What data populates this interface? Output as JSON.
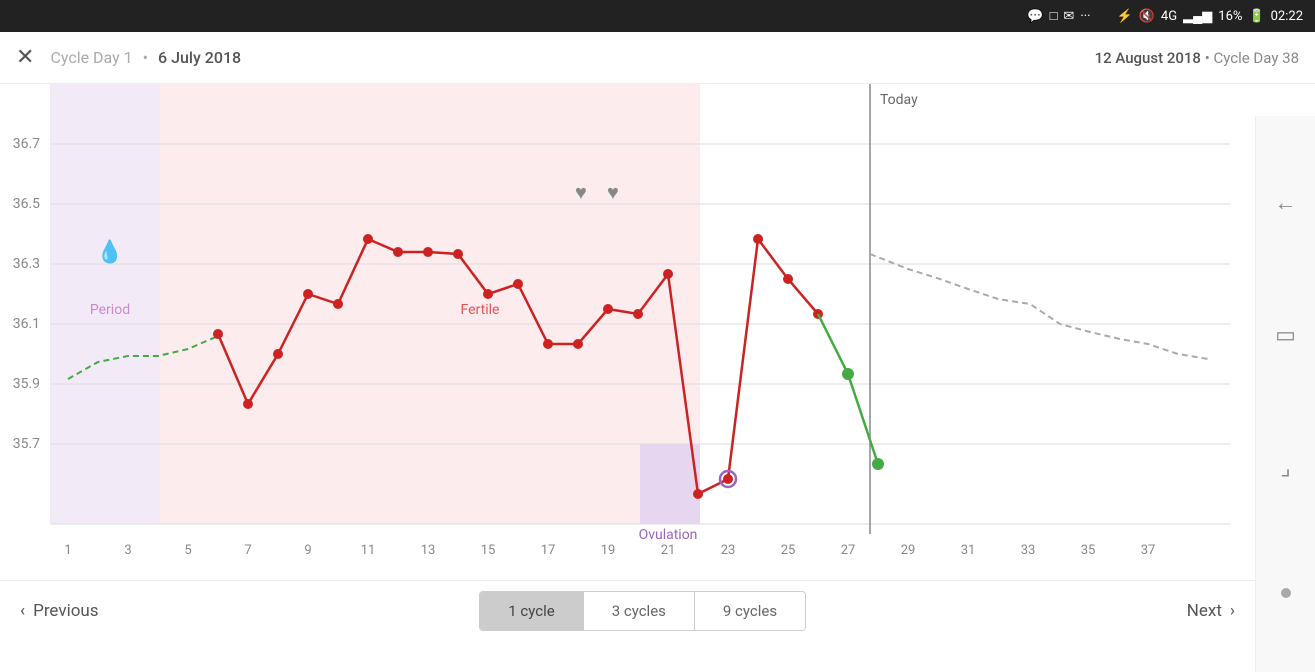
{
  "statusBar": {
    "icons": "bluetooth wifi signal battery",
    "battery": "16%",
    "time": "02:22"
  },
  "header": {
    "cycleDay": "Cycle Day 1",
    "dot": "•",
    "date": "6 July 2018",
    "rightDate": "12 August 2018",
    "rightDot": "•",
    "rightCycleDay": "Cycle Day 38"
  },
  "chart": {
    "yLabels": [
      "36.7",
      "36.5",
      "36.3",
      "36.1",
      "35.9",
      "35.7"
    ],
    "xLabels": [
      "1",
      "3",
      "5",
      "7",
      "9",
      "11",
      "13",
      "15",
      "17",
      "19",
      "21",
      "23",
      "25",
      "27",
      "29",
      "31",
      "33",
      "35",
      "37"
    ],
    "labels": {
      "period": "Period",
      "fertile": "Fertile",
      "ovulation": "Ovulation",
      "today": "Today"
    }
  },
  "bottomBar": {
    "prevLabel": "Previous",
    "tabs": [
      {
        "label": "1 cycle",
        "active": true
      },
      {
        "label": "3 cycles",
        "active": false
      },
      {
        "label": "9 cycles",
        "active": false
      }
    ],
    "nextLabel": "Next"
  },
  "icons": {
    "close": "✕",
    "prevArrow": "‹",
    "nextArrow": "›",
    "backArrow": "←",
    "squareIcon": "▭",
    "cornerIcon": "⌟"
  }
}
